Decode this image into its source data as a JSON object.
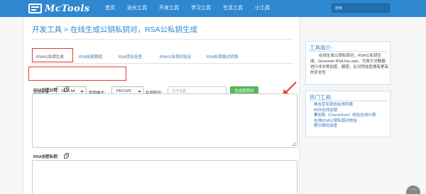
{
  "header": {
    "logo_text": "McTools",
    "nav": [
      "首页",
      "站长工具",
      "开发工具",
      "学习工具",
      "生活工具",
      "小工具"
    ],
    "search_placeholder": "搜索"
  },
  "main": {
    "title": "开发工具 > 在线生成公钥私钥对，RSA公私钥生成",
    "tabs": [
      "RSA公私钥生成",
      "RSA加密解密",
      "RSA签名验签",
      "RSA公私钥对验证",
      "RSA私钥格式转换"
    ],
    "active_tab": 0,
    "options": {
      "key_length_label": "密钥长度：",
      "key_length_value": "1024 bit",
      "key_format_label": "密钥格式：",
      "key_format_value": "PKCS#1",
      "password_label": "私钥密码：",
      "password_placeholder": "可不设置",
      "generate_button": "生成密钥对"
    },
    "public_key_label": "RSA加密公钥：",
    "private_key_label": "RSA加密私钥："
  },
  "sidebar": {
    "intro_title": "工具简介:",
    "intro_text": "在线生成公钥私钥对，RSA公私钥生成，Generate RSA key pair，可用于对数据进行非对称加密、解密，比对称加密拥有更高的安全性",
    "hot_title": "热门工具:",
    "hot_tools": [
      "维吉尼亚密码在线转换",
      "MD5在线加密",
      "累加和（CheckSum）校验在线计算",
      "在线RSA公钥私钥对校验",
      "摩尔斯码加密"
    ]
  },
  "colors": {
    "header_bg": "#2f87cf",
    "accent": "#2f87cf",
    "button_green": "#5cb85c",
    "highlight_red": "#e53935"
  }
}
